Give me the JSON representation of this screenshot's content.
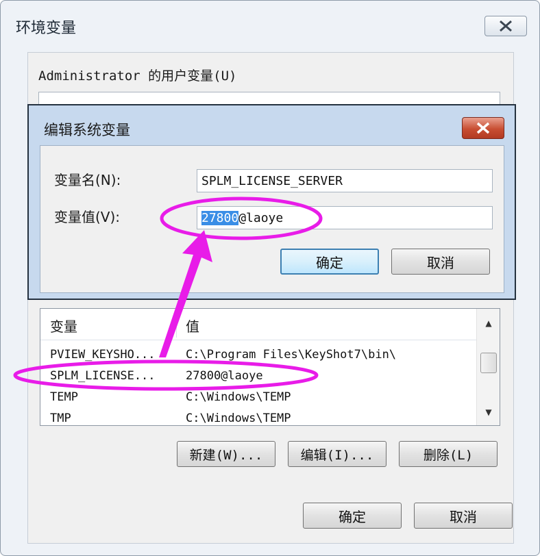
{
  "outer": {
    "title": "环境变量",
    "user_vars_label": "Administrator 的用户变量(U)",
    "ok_label": "确定",
    "cancel_label": "取消"
  },
  "edit_dialog": {
    "title": "编辑系统变量",
    "name_label": "变量名(N):",
    "value_label": "变量值(V):",
    "name_value": "SPLM_LICENSE_SERVER",
    "value_selected": "27800",
    "value_rest": "@laoye",
    "ok_label": "确定",
    "cancel_label": "取消"
  },
  "sys_table": {
    "columns": [
      "变量",
      "值"
    ],
    "rows": [
      {
        "name": "PVIEW_KEYSHO...",
        "value": "C:\\Program Files\\KeyShot7\\bin\\"
      },
      {
        "name": "SPLM_LICENSE...",
        "value": "27800@laoye"
      },
      {
        "name": "TEMP",
        "value": "C:\\Windows\\TEMP"
      },
      {
        "name": "TMP",
        "value": "C:\\Windows\\TEMP"
      }
    ]
  },
  "sys_buttons": {
    "new_label": "新建(W)...",
    "edit_label": "编辑(I)...",
    "delete_label": "删除(L)"
  },
  "icons": {
    "close": "close-icon",
    "scroll_up": "scroll-up-arrow-icon",
    "scroll_down": "scroll-down-arrow-icon"
  },
  "colors": {
    "annotation": "#e81ce8",
    "selection": "#3a8ee6",
    "dialog_frame": "#c7d9ee"
  }
}
